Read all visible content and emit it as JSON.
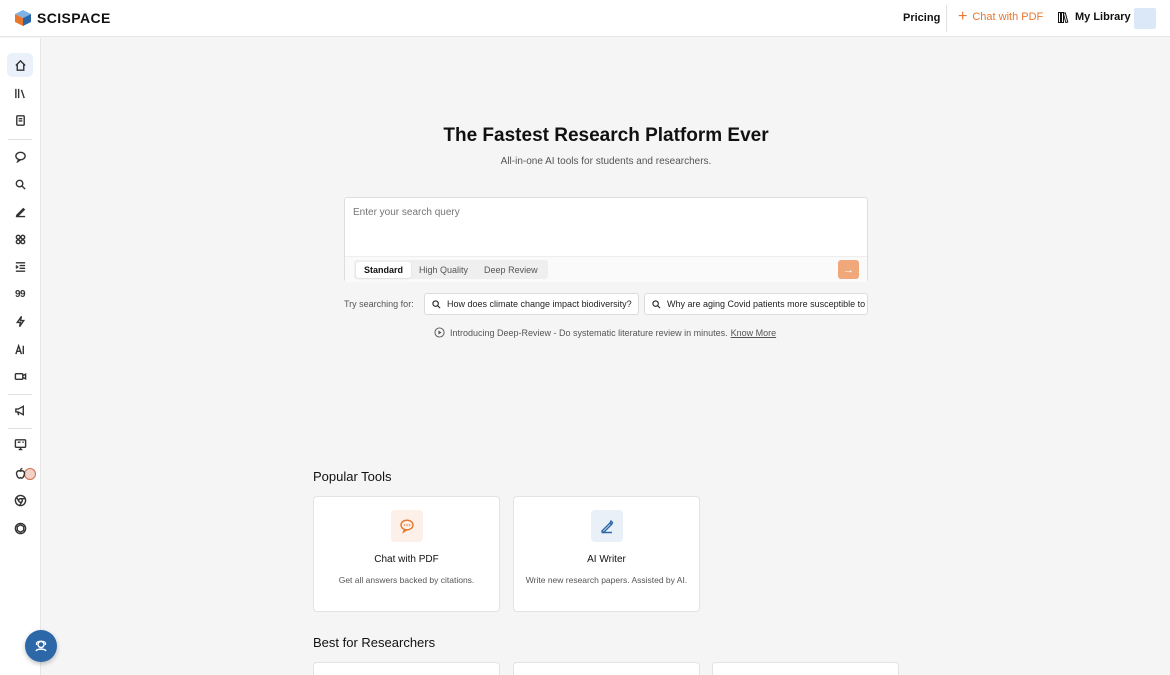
{
  "brand": {
    "name": "SCISPACE"
  },
  "header": {
    "pricing": "Pricing",
    "chat_with_pdf": "Chat with PDF",
    "my_library": "My Library"
  },
  "sidebar": {
    "items": [
      {
        "icon": "home-icon",
        "active": true
      },
      {
        "icon": "library-icon"
      },
      {
        "icon": "notebook-icon"
      },
      {
        "icon": "chat-icon"
      },
      {
        "icon": "search-literature-icon"
      },
      {
        "icon": "pen-icon"
      },
      {
        "icon": "extract-icon"
      },
      {
        "icon": "list-indent-icon"
      },
      {
        "icon": "citation-icon",
        "text": "99"
      },
      {
        "icon": "lightning-icon"
      },
      {
        "icon": "ai-detector-icon"
      },
      {
        "icon": "video-icon"
      },
      {
        "icon": "megaphone-icon"
      },
      {
        "icon": "translate-icon"
      },
      {
        "icon": "apple-icon"
      },
      {
        "icon": "chrome-icon"
      },
      {
        "icon": "openai-icon"
      }
    ]
  },
  "hero": {
    "title": "The Fastest Research Platform Ever",
    "subtitle": "All-in-one AI tools for students and researchers."
  },
  "search": {
    "placeholder": "Enter your search query",
    "modes": [
      "Standard",
      "High Quality",
      "Deep Review"
    ],
    "selected_mode": "Standard",
    "try_label": "Try searching for:",
    "suggestions": [
      "How does climate change impact biodiversity?",
      "Why are aging Covid patients more susceptible to"
    ],
    "intro_text": "Introducing Deep-Review - Do systematic literature review in minutes.",
    "intro_link": "Know More"
  },
  "popular_tools": {
    "title": "Popular Tools",
    "tools": [
      {
        "name": "Chat with PDF",
        "desc": "Get all answers backed by citations."
      },
      {
        "name": "AI Writer",
        "desc": "Write new research papers. Assisted by AI."
      }
    ]
  },
  "best_for_researchers": {
    "title": "Best for Researchers"
  },
  "colors": {
    "accent": "#e8772e",
    "primary": "#2c68a8"
  }
}
